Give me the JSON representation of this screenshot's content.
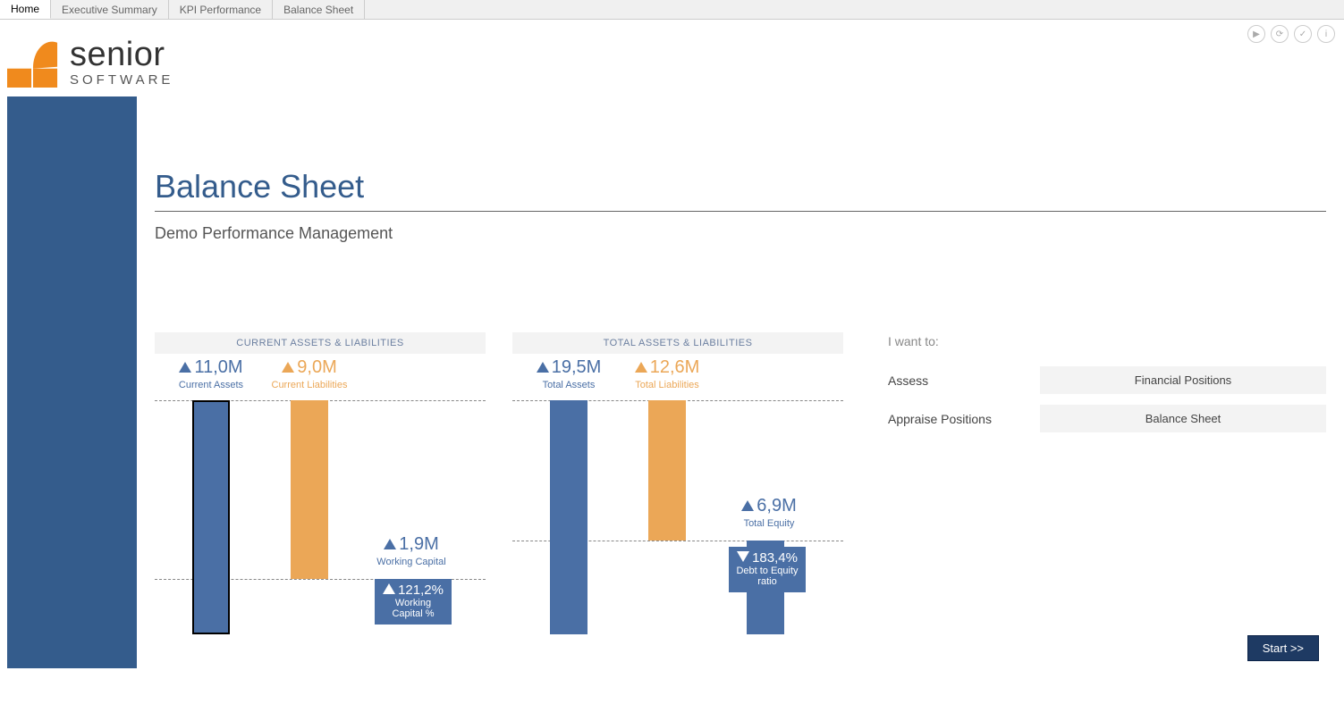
{
  "tabs": [
    "Home",
    "Executive Summary",
    "KPI Performance",
    "Balance Sheet"
  ],
  "active_tab": 0,
  "logo": {
    "name": "senior",
    "sub": "SOFTWARE"
  },
  "page": {
    "title": "Balance Sheet",
    "subtitle": "Demo Performance Management"
  },
  "right": {
    "title": "I want to:",
    "rows": [
      {
        "label": "Assess",
        "box": "Financial Positions"
      },
      {
        "label": "Appraise Positions",
        "box": "Balance Sheet"
      }
    ],
    "start": "Start >>"
  },
  "chart_data": [
    {
      "type": "bar",
      "title": "CURRENT ASSETS & LIABILITIES",
      "series": [
        {
          "name": "Current Assets",
          "value": 11.0,
          "direction": "up",
          "color": "#4a6fa5",
          "display": "11,0M"
        },
        {
          "name": "Current Liabilities",
          "value": 9.0,
          "direction": "up",
          "color": "#eba757",
          "display": "9,0M"
        },
        {
          "name": "Working Capital",
          "value": 1.9,
          "direction": "up",
          "color": "#4a6fa5",
          "display": "1,9M"
        }
      ],
      "box_metric": {
        "name": "Working Capital %",
        "value": 121.2,
        "direction": "up",
        "display": "121,2%"
      }
    },
    {
      "type": "bar",
      "title": "TOTAL ASSETS & LIABILITIES",
      "series": [
        {
          "name": "Total Assets",
          "value": 19.5,
          "direction": "up",
          "color": "#4a6fa5",
          "display": "19,5M"
        },
        {
          "name": "Total Liabilities",
          "value": 12.6,
          "direction": "up",
          "color": "#eba757",
          "display": "12,6M"
        },
        {
          "name": "Total Equity",
          "value": 6.9,
          "direction": "up",
          "color": "#4a6fa5",
          "display": "6,9M"
        }
      ],
      "box_metric": {
        "name": "Debt to Equity ratio",
        "value": 183.4,
        "direction": "down",
        "display": "183,4%"
      }
    }
  ]
}
